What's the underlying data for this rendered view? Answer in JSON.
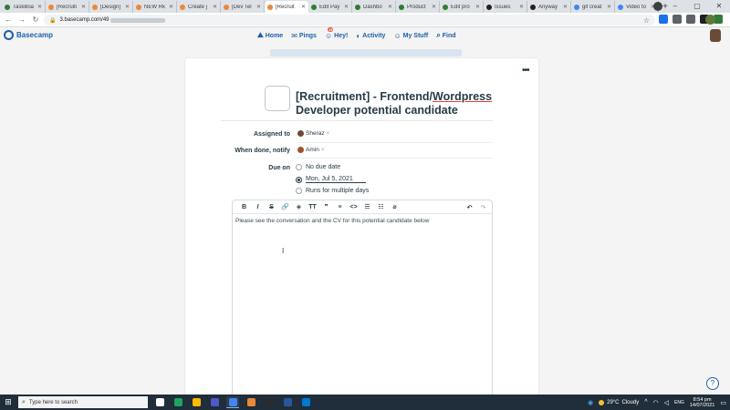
{
  "browser": {
    "tabs": [
      {
        "label": "TaskBoa",
        "color": "#2e7d32",
        "active": false
      },
      {
        "label": "[Recruiti",
        "color": "#e8893a",
        "active": false
      },
      {
        "label": "[Design]",
        "color": "#e8893a",
        "active": false
      },
      {
        "label": "NEW Rk",
        "color": "#e8893a",
        "active": false
      },
      {
        "label": "Create j",
        "color": "#e8893a",
        "active": false
      },
      {
        "label": "[Dev Tel",
        "color": "#e8893a",
        "active": false
      },
      {
        "label": "[Recruit",
        "color": "#e8893a",
        "active": true
      },
      {
        "label": "Edit Pay",
        "color": "#2e7d32",
        "active": false
      },
      {
        "label": "Dashbo",
        "color": "#2e7d32",
        "active": false
      },
      {
        "label": "Product",
        "color": "#2e7d32",
        "active": false
      },
      {
        "label": "Edit pro",
        "color": "#2e7d32",
        "active": false
      },
      {
        "label": "Issues",
        "color": "#202124",
        "active": false
      },
      {
        "label": "Anyway",
        "color": "#202124",
        "active": false
      },
      {
        "label": "gif creat",
        "color": "#4285f4",
        "active": false
      },
      {
        "label": "Video to",
        "color": "#4285f4",
        "active": false
      }
    ],
    "new_tab": "+",
    "minimize": "–",
    "maximize": "▢",
    "close": "✕",
    "url": "3.basecamp.com/49",
    "back": "←",
    "forward": "→",
    "reload": "↻",
    "star": "☆",
    "menu": "⋮",
    "extension_colors": [
      "#1a73e8",
      "#5f6368",
      "#5f6368",
      "#202124",
      "#2e7d32"
    ]
  },
  "app": {
    "logo_text": "Basecamp",
    "nav": [
      {
        "label": "Home",
        "icon": "⛰"
      },
      {
        "label": "Pings",
        "icon": "✉"
      },
      {
        "label": "Hey!",
        "icon": "☺",
        "badge": "15"
      },
      {
        "label": "Activity",
        "icon": "◐"
      },
      {
        "label": "My Stuff",
        "icon": "☺"
      },
      {
        "label": "Find",
        "icon": "⌕"
      }
    ],
    "card_menu": "•••"
  },
  "todo": {
    "title_part1": "[Recruitment] - Frontend/",
    "title_underlined": "Wordpress",
    "title_part2": "Developer potential candidate",
    "assigned_to_label": "Assigned to",
    "assignee": "Sheraz",
    "notify_label": "When done, notify",
    "notify_person": "Amin",
    "chip_remove": "×",
    "due_on_label": "Due on",
    "due_options": [
      "No due date",
      "Mon, Jul 5, 2021",
      "Runs for multiple days"
    ],
    "notes_text": "Please see the conversation and the CV for this potential candidate below"
  },
  "editor_toolbar": {
    "bold": "B",
    "italic": "I",
    "strike": "S",
    "link": "🔗",
    "color": "◈",
    "heading": "TT",
    "quote": "❞",
    "divider": "≡",
    "code": "<>",
    "bullets": "☰",
    "numbers": "☷",
    "attach": "⌀",
    "undo": "↶",
    "redo": "↷"
  },
  "help": "?",
  "taskbar": {
    "start": "⊞",
    "search_placeholder": "Type here to search",
    "apps": [
      "#ffffff",
      "#1ea362",
      "#ffb900",
      "#5059c9",
      "#4285f4",
      "#e8893a",
      "#2b2b2b",
      "#2b579a",
      "#0078d4"
    ],
    "temperature": "29°C",
    "weather": "Cloudy",
    "time": "8:54 pm",
    "date": "14/07/2021",
    "chevron": "^",
    "wifi": "◠",
    "volume": "◁",
    "lang": "ENG"
  }
}
